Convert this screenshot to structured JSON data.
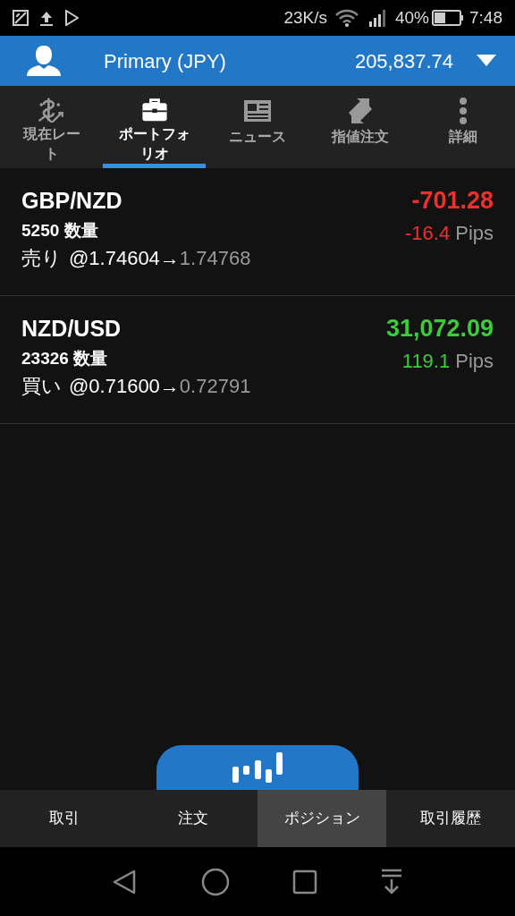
{
  "status_bar": {
    "speed": "23K/s",
    "battery": "40%",
    "time": "7:48"
  },
  "account": {
    "name": "Primary (JPY)",
    "balance": "205,837.74"
  },
  "tabs": [
    {
      "label": "現在レート",
      "selected": false
    },
    {
      "label": "ポートフォリオ",
      "selected": true
    },
    {
      "label": "ニュース",
      "selected": false
    },
    {
      "label": "指値注文",
      "selected": false
    },
    {
      "label": "詳細",
      "selected": false
    }
  ],
  "positions": [
    {
      "pair": "GBP/NZD",
      "profit": "-701.28",
      "color": "#f0302e",
      "quantity": "5250 数量",
      "pips": "-16.4",
      "pips_unit": "Pips",
      "side": "売り",
      "open": "@1.74604→",
      "current": "1.74768"
    },
    {
      "pair": "NZD/USD",
      "profit": "31,072.09",
      "color": "#3ccb3c",
      "quantity": "23326 数量",
      "pips": "119.1",
      "pips_unit": "Pips",
      "side": "買い",
      "open": "@0.71600→",
      "current": "0.72791"
    }
  ],
  "bottom_tabs": [
    {
      "label": "取引",
      "selected": false
    },
    {
      "label": "注文",
      "selected": false
    },
    {
      "label": "ポジション",
      "selected": true
    },
    {
      "label": "取引履歴",
      "selected": false
    }
  ]
}
